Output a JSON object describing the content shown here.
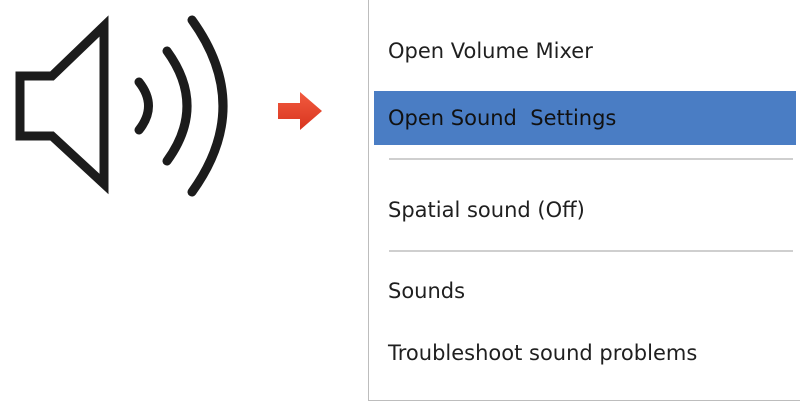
{
  "icons": {
    "speaker": "speaker-volume-icon",
    "arrow": "right-arrow-icon"
  },
  "colors": {
    "selected_background": "#4a7dc4",
    "arrow_fill": "#e8432c",
    "icon_stroke": "#1c1c1c",
    "separator": "#cfcfcf"
  },
  "menu": {
    "items": [
      {
        "label": "Open Volume Mixer",
        "selected": false
      },
      {
        "label": "Open Sound  Settings",
        "selected": true
      },
      {
        "label": "Spatial sound (Off)",
        "selected": false
      },
      {
        "label": "Sounds",
        "selected": false
      },
      {
        "label": "Troubleshoot sound problems",
        "selected": false
      }
    ]
  }
}
